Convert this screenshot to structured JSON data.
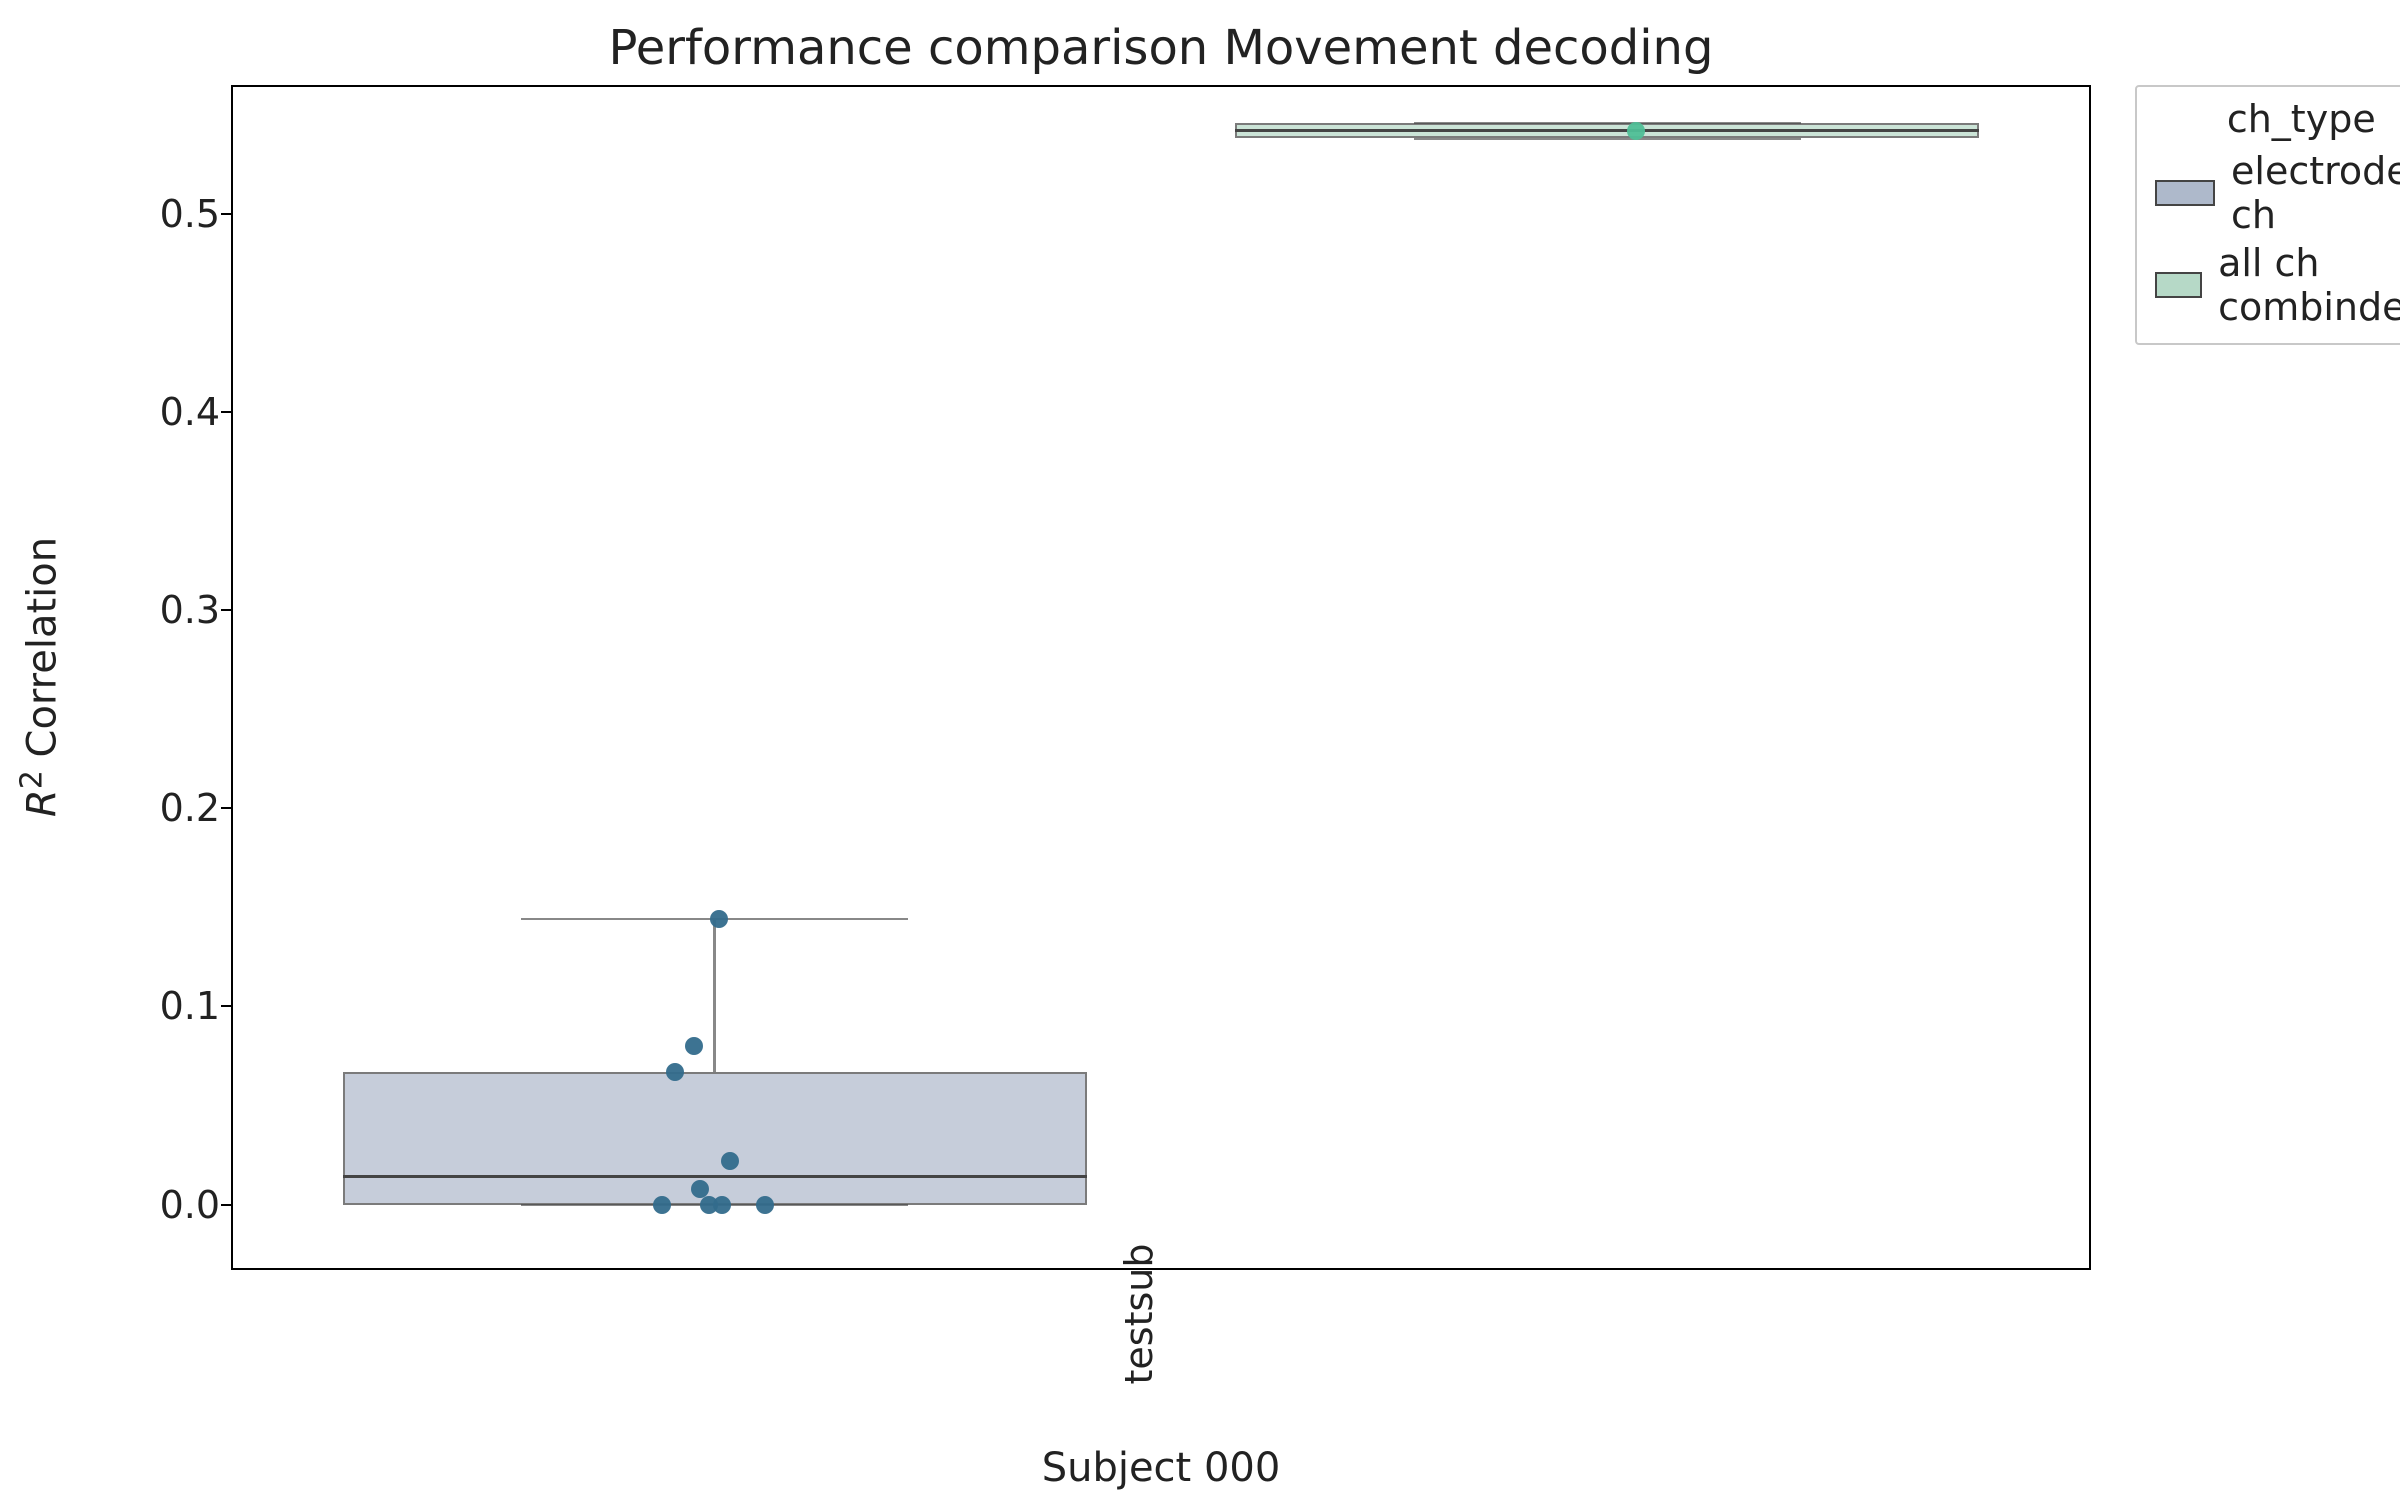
{
  "chart_data": {
    "type": "box",
    "title": "Performance comparison Movement decoding",
    "xlabel": "Subject 000",
    "ylabel_html": "<i>R</i><sup>2</sup> Correlation",
    "x_categories": [
      "testsub"
    ],
    "yticks": [
      0.0,
      0.1,
      0.2,
      0.3,
      0.4,
      0.5
    ],
    "ylim": [
      -0.033,
      0.565
    ],
    "legend": {
      "title": "ch_type",
      "entries": [
        {
          "label": "electrode ch",
          "color": "#aeb9cb"
        },
        {
          "label": "all ch combinded",
          "color": "#b6d9c7"
        }
      ]
    },
    "series": [
      {
        "name": "electrode ch",
        "color_box": "#aeb9cb",
        "color_point": "#336b8c",
        "box": {
          "q1": 0.0,
          "median": 0.014,
          "q3": 0.067,
          "whisker_lo": 0.0,
          "whisker_hi": 0.144
        },
        "points": [
          0.0,
          0.0,
          0.0,
          0.008,
          0.0,
          0.022,
          0.067,
          0.08,
          0.144
        ]
      },
      {
        "name": "all ch combinded",
        "color_box": "#b6d9c7",
        "color_point": "#4fbf97",
        "box": {
          "q1": 0.538,
          "median": 0.542,
          "q3": 0.546,
          "whisker_lo": 0.538,
          "whisker_hi": 0.546
        },
        "points": [
          0.542
        ]
      }
    ]
  }
}
